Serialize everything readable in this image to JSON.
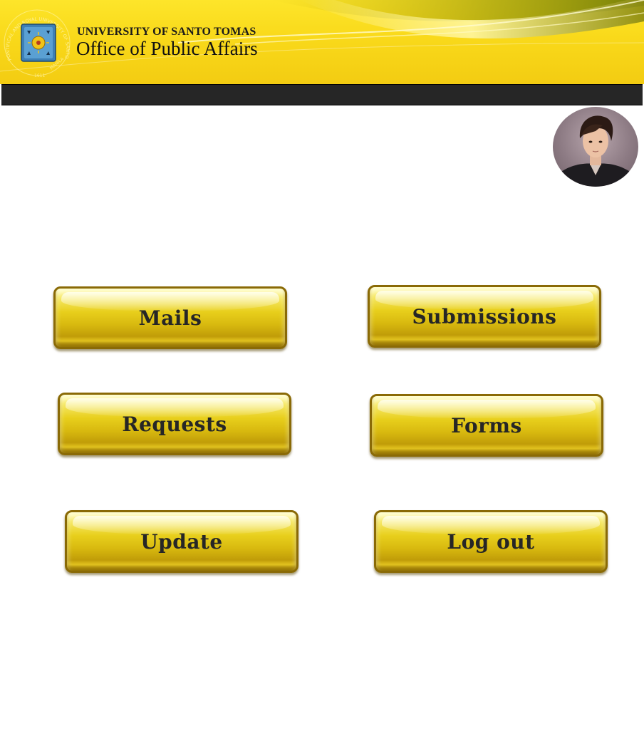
{
  "header": {
    "university": "UNIVERSITY OF SANTO TOMAS",
    "office": "Office of Public Affairs",
    "seal_text": "PONTIFICAL AND ROYAL UNIVERSITY OF SANTO TOMAS",
    "seal_year": "1611",
    "seal_city": "MANILA",
    "colors": {
      "banner": "#f9d91a",
      "navbar": "#262626"
    }
  },
  "profile": {
    "avatar_icon": "user-avatar"
  },
  "menu": {
    "mails": "Mails",
    "submissions": "Submissions",
    "requests": "Requests",
    "forms": "Forms",
    "update": "Update",
    "logout": "Log out"
  },
  "colors": {
    "button_gold": "#e8cf1c",
    "button_text": "#262626"
  }
}
